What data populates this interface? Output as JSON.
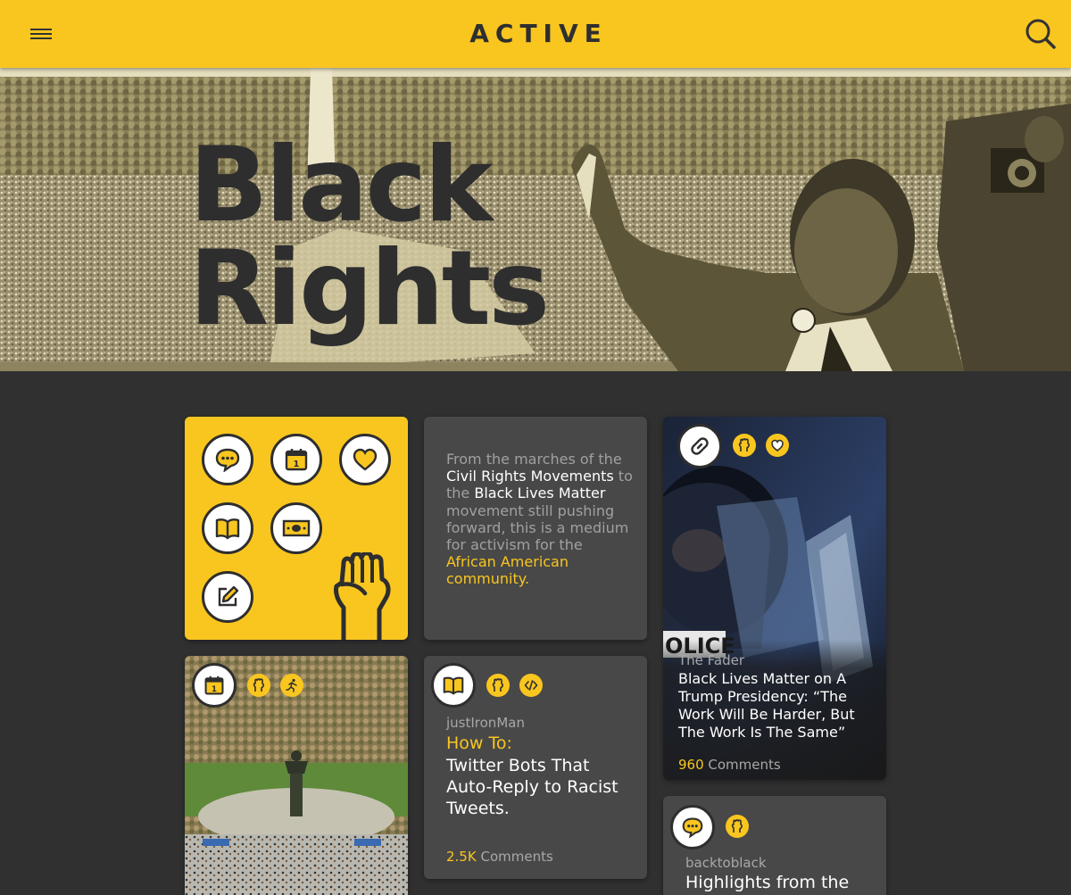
{
  "header": {
    "title": "ACTIVE",
    "menu_icon": "hamburger-icon",
    "search_icon": "search-icon",
    "background": "#f9c61f"
  },
  "hero": {
    "title_line1": "Black",
    "title_line2": "Rights"
  },
  "quick_actions": {
    "icons": [
      "chat-icon",
      "calendar-icon",
      "heart-icon",
      "book-icon",
      "money-icon",
      "edit-icon"
    ],
    "decoration": "raised-fist-icon"
  },
  "intro": {
    "p1": "From the marches of the ",
    "h1": "Civil Rights Movements",
    "p2": " to the ",
    "h2": "Black Lives Matter",
    "p3": " movement still pushing forward, this is a medium for activism for the ",
    "h3": "African American community."
  },
  "cards": {
    "riot": {
      "icons": [
        "link-icon",
        "fist-icon",
        "heart-icon"
      ],
      "source": "The Fader",
      "title": "Black Lives Matter on A Trump Presidency: “The Work Will Be Harder, But The Work Is The Same”",
      "comment_count": "960",
      "comment_label": " Comments"
    },
    "park": {
      "icons": [
        "calendar-icon",
        "fist-icon",
        "runner-icon"
      ]
    },
    "howto": {
      "icons": [
        "book-icon",
        "fist-icon",
        "code-icon"
      ],
      "author": "justIronMan",
      "kicker": "How To:",
      "title": "Twitter Bots That Auto-Reply to Racist Tweets.",
      "comment_count": "2.5K",
      "comment_label": " Comments"
    },
    "back": {
      "icons": [
        "chat-icon",
        "fist-icon"
      ],
      "author": "backtoblack",
      "title": "Highlights from the"
    }
  },
  "colors": {
    "accent": "#f9c61f",
    "dark": "#303030",
    "card": "#484848"
  }
}
